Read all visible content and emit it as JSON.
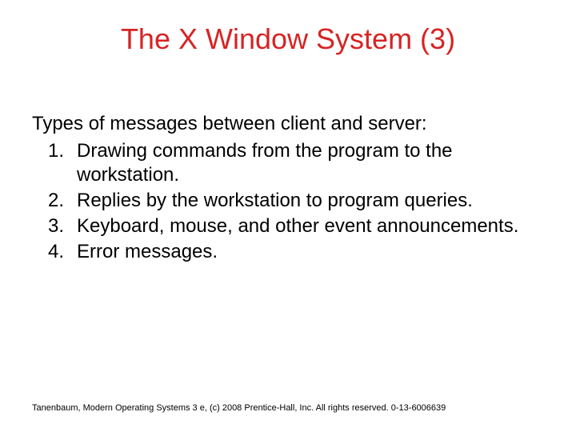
{
  "title": "The X Window System (3)",
  "intro": "Types of messages between client and server:",
  "items": [
    {
      "num": "1.",
      "text": "Drawing commands from the program to the workstation."
    },
    {
      "num": "2.",
      "text": "Replies by the workstation to program queries."
    },
    {
      "num": "3.",
      "text": "Keyboard, mouse, and other event announcements."
    },
    {
      "num": "4.",
      "text": "Error messages."
    }
  ],
  "footer": "Tanenbaum, Modern Operating Systems 3 e, (c) 2008 Prentice-Hall, Inc. All rights reserved. 0-13-6006639"
}
